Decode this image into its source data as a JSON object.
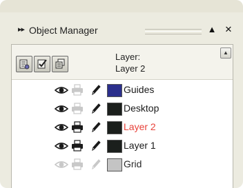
{
  "panel": {
    "title": "Object Manager",
    "minimize_symbol": "▲",
    "close_symbol": "✕"
  },
  "toolbar": {
    "buttons": [
      {
        "name": "show-properties-icon"
      },
      {
        "name": "edit-across-layers-icon"
      },
      {
        "name": "layer-manager-view-icon"
      }
    ],
    "current_layer_label": "Layer:",
    "current_layer_name": "Layer 2",
    "scroll_symbol": "▲"
  },
  "layers": [
    {
      "name": "Guides",
      "color": "#2b2f8c",
      "visible": true,
      "printable": false,
      "editable": true,
      "active": false
    },
    {
      "name": "Desktop",
      "color": "#1b1f1c",
      "visible": true,
      "printable": false,
      "editable": true,
      "active": false
    },
    {
      "name": "Layer 2",
      "color": "#1b1f1c",
      "visible": true,
      "printable": true,
      "editable": true,
      "active": true
    },
    {
      "name": "Layer 1",
      "color": "#1b1f1c",
      "visible": true,
      "printable": true,
      "editable": true,
      "active": false
    },
    {
      "name": "Grid",
      "color": "#c4c4c4",
      "visible": false,
      "printable": false,
      "editable": false,
      "active": false
    }
  ],
  "colors": {
    "active_layer_text": "#e8423a",
    "normal_layer_text": "#1a1a1a",
    "disabled_icon": "#c8c8c8",
    "enabled_icon": "#1a1a1a"
  }
}
